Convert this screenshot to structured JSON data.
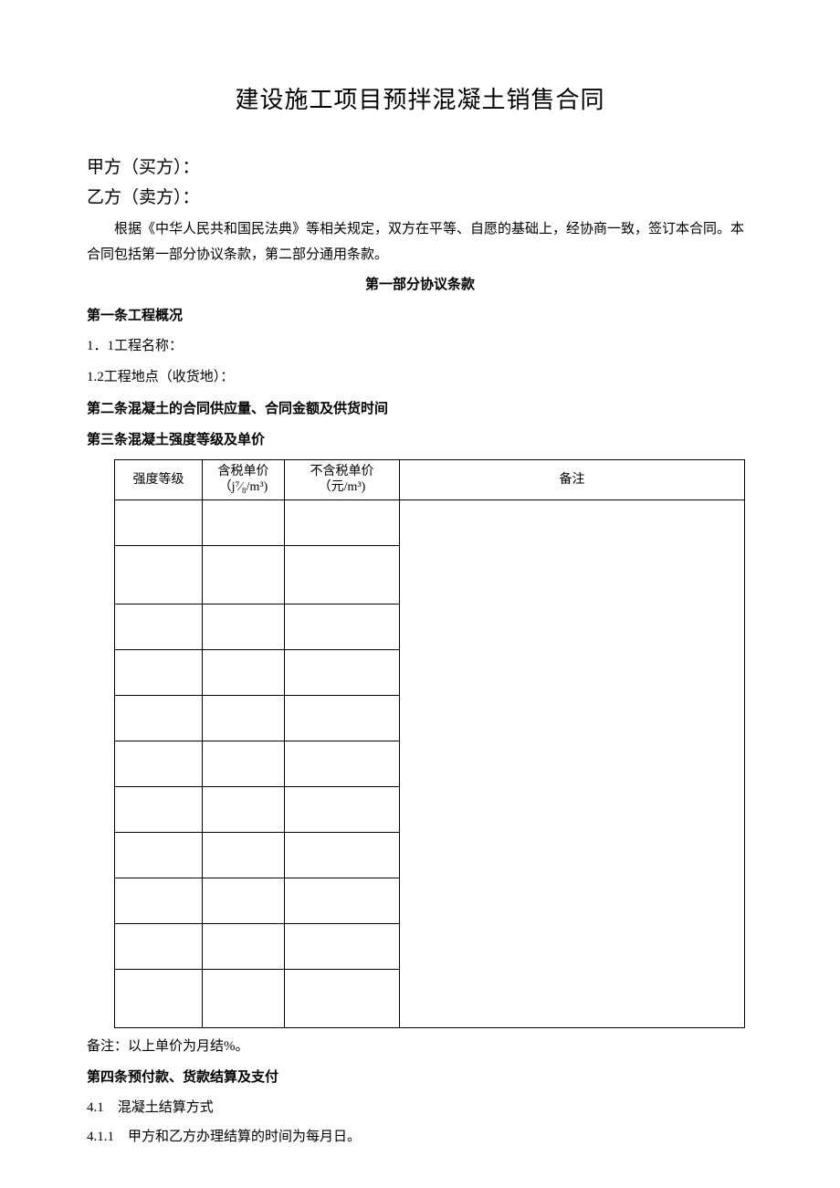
{
  "title": "建设施工项目预拌混凝土销售合同",
  "parties": {
    "buyer": "甲方（买方）：",
    "seller": "乙方（卖方）："
  },
  "intro": "根据《中华人民共和国民法典》等相关规定，双方在平等、自愿的基础上，经协商一致，签订本合同。本合同包括第一部分协议条款，第二部分通用条款。",
  "part1_heading": "第一部分协议条款",
  "article1": {
    "heading": "第一条工程概况",
    "line1": "1．1工程名称：",
    "line2": "1.2工程地点（收货地）："
  },
  "article2_heading": "第二条混凝土的合同供应量、合同金额及供货时间",
  "article3_heading": "第三条混凝土强度等级及单价",
  "table": {
    "headers": {
      "grade": "强度等级",
      "tax_price": "含税单价（j⁷⁄₈/m³)",
      "notax_price": "不含税单价（元/m³)",
      "remark": "备注"
    },
    "rows": [
      {
        "grade": "",
        "tax": "",
        "notax": ""
      },
      {
        "grade": "",
        "tax": "",
        "notax": ""
      },
      {
        "grade": "",
        "tax": "",
        "notax": ""
      },
      {
        "grade": "",
        "tax": "",
        "notax": ""
      },
      {
        "grade": "",
        "tax": "",
        "notax": ""
      },
      {
        "grade": "",
        "tax": "",
        "notax": ""
      },
      {
        "grade": "",
        "tax": "",
        "notax": ""
      },
      {
        "grade": "",
        "tax": "",
        "notax": ""
      },
      {
        "grade": "",
        "tax": "",
        "notax": ""
      },
      {
        "grade": "",
        "tax": "",
        "notax": ""
      },
      {
        "grade": "",
        "tax": "",
        "notax": ""
      }
    ],
    "remark_body": ""
  },
  "table_note": "备注：以上单价为月结%。",
  "article4": {
    "heading": "第四条预付款、货款结算及支付",
    "line41": "4.1　混凝土结算方式",
    "line411": "4.1.1　甲方和乙方办理结算的时间为每月日。"
  }
}
